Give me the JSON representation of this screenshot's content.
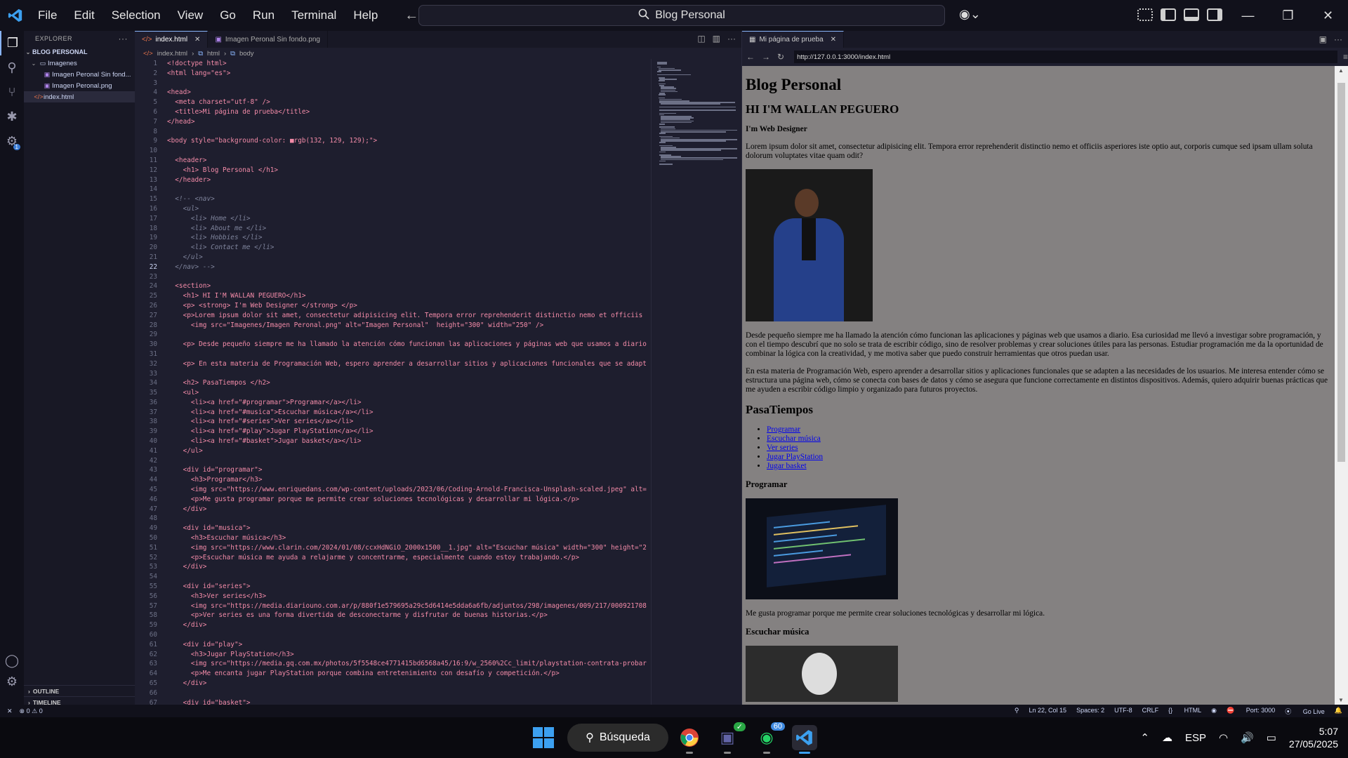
{
  "menu": [
    "File",
    "Edit",
    "Selection",
    "View",
    "Go",
    "Run",
    "Terminal",
    "Help"
  ],
  "command_center": "Blog Personal",
  "sidebar": {
    "title": "EXPLORER",
    "project": "BLOG PERSONAL",
    "items": [
      {
        "label": "Imagenes",
        "type": "folder"
      },
      {
        "label": "Imagen Peronal Sin fond...",
        "type": "image"
      },
      {
        "label": "Imagen Peronal.png",
        "type": "image"
      },
      {
        "label": "index.html",
        "type": "html"
      }
    ],
    "outline": "OUTLINE",
    "timeline": "TIMELINE"
  },
  "tabs": [
    {
      "label": "index.html",
      "active": true
    },
    {
      "label": "Imagen Peronal Sin fondo.png",
      "active": false
    }
  ],
  "breadcrumb": [
    "index.html",
    "html",
    "body"
  ],
  "code_lines": [
    "<!doctype html>",
    "<html lang=\"es\">",
    "",
    "<head>",
    "  <meta charset=\"utf-8\" />",
    "  <title>Mi página de prueba</title>",
    "</head>",
    "",
    "<body style=\"background-color: ■rgb(132, 129, 129);\">",
    "",
    "  <header>",
    "    <h1> Blog Personal </h1>",
    "  </header>",
    "",
    "  <!-- <nav>",
    "    <ul>",
    "      <li> Home </li>",
    "      <li> About me </li>",
    "      <li> Hobbies </li>",
    "      <li> Contact me </li>",
    "    </ul>",
    "  </nav> -->",
    "",
    "  <section>",
    "    <h1> HI I'M WALLAN PEGUERO</h1>",
    "    <p> <strong> I'm Web Designer </strong> </p>",
    "    <p>Lorem ipsum dolor sit amet, consectetur adipisicing elit. Tempora error reprehenderit distinctio nemo et officiis",
    "      <img src=\"Imagenes/Imagen Peronal.png\" alt=\"Imagen Personal\"  height=\"300\" width=\"250\" />",
    "",
    "    <p> Desde pequeño siempre me ha llamado la atención cómo funcionan las aplicaciones y páginas web que usamos a diario",
    "",
    "    <p> En esta materia de Programación Web, espero aprender a desarrollar sitios y aplicaciones funcionales que se adapt",
    "",
    "    <h2> PasaTiempos </h2>",
    "    <ul>",
    "      <li><a href=\"#programar\">Programar</a></li>",
    "      <li><a href=\"#musica\">Escuchar música</a></li>",
    "      <li><a href=\"#series\">Ver series</a></li>",
    "      <li><a href=\"#play\">Jugar PlayStation</a></li>",
    "      <li><a href=\"#basket\">Jugar basket</a></li>",
    "    </ul>",
    "",
    "    <div id=\"programar\">",
    "      <h3>Programar</h3>",
    "      <img src=\"https://www.enriquedans.com/wp-content/uploads/2023/06/Coding-Arnold-Francisca-Unsplash-scaled.jpeg\" alt=",
    "      <p>Me gusta programar porque me permite crear soluciones tecnológicas y desarrollar mi lógica.</p>",
    "    </div>",
    "",
    "    <div id=\"musica\">",
    "      <h3>Escuchar música</h3>",
    "      <img src=\"https://www.clarin.com/2024/01/08/ccxHdNGiO_2000x1500__1.jpg\" alt=\"Escuchar música\" width=\"300\" height=\"2",
    "      <p>Escuchar música me ayuda a relajarme y concentrarme, especialmente cuando estoy trabajando.</p>",
    "    </div>",
    "",
    "    <div id=\"series\">",
    "      <h3>Ver series</h3>",
    "      <img src=\"https://media.diariouno.com.ar/p/880f1e579695a29c5d6414e5dda6a6fb/adjuntos/298/imagenes/009/217/000921708",
    "      <p>Ver series es una forma divertida de desconectarme y disfrutar de buenas historias.</p>",
    "    </div>",
    "",
    "    <div id=\"play\">",
    "      <h3>Jugar PlayStation</h3>",
    "      <img src=\"https://media.gq.com.mx/photos/5f5548ce4771415bd6568a45/16:9/w_2560%2Cc_limit/playstation-contrata-probar",
    "      <p>Me encanta jugar PlayStation porque combina entretenimiento con desafío y competición.</p>",
    "    </div>",
    "",
    "    <div id=\"basket\">"
  ],
  "current_line": 22,
  "preview": {
    "tab": "Mi página de prueba",
    "url": "http://127.0.0.1:3000/index.html",
    "h1": "Blog Personal",
    "h1b": "HI I'M WALLAN PEGUERO",
    "role": "I'm Web Designer",
    "lorem": "Lorem ipsum dolor sit amet, consectetur adipisicing elit. Tempora error reprehenderit distinctio nemo et officiis asperiores iste optio aut, corporis cumque sed ipsam ullam soluta dolorum voluptates vitae quam odit?",
    "p1": "Desde pequeño siempre me ha llamado la atención cómo funcionan las aplicaciones y páginas web que usamos a diario. Esa curiosidad me llevó a investigar sobre programación, y con el tiempo descubrí que no solo se trata de escribir código, sino de resolver problemas y crear soluciones útiles para las personas. Estudiar programación me da la oportunidad de combinar la lógica con la creatividad, y me motiva saber que puedo construir herramientas que otros puedan usar.",
    "p2": "En esta materia de Programación Web, espero aprender a desarrollar sitios y aplicaciones funcionales que se adapten a las necesidades de los usuarios. Me interesa entender cómo se estructura una página web, cómo se conecta con bases de datos y cómo se asegura que funcione correctamente en distintos dispositivos. Además, quiero adquirir buenas prácticas que me ayuden a escribir código limpio y organizado para futuros proyectos.",
    "h2": "PasaTiempos",
    "links": [
      "Programar",
      "Escuchar música",
      "Ver series",
      "Jugar PlayStation",
      "Jugar basket"
    ],
    "h3a": "Programar",
    "pa": "Me gusta programar porque me permite crear soluciones tecnológicas y desarrollar mi lógica.",
    "h3b": "Escuchar música"
  },
  "status": {
    "errors": "0",
    "warnings": "0",
    "position": "Ln 22, Col 15",
    "spaces": "Spaces: 2",
    "encoding": "UTF-8",
    "eol": "CRLF",
    "language": "HTML",
    "port": "Port: 3000",
    "golive": "Go Live"
  },
  "taskbar": {
    "search": "Búsqueda",
    "whatsapp_badge": "60",
    "lang": "ESP",
    "time": "5:07",
    "date": "27/05/2025"
  }
}
